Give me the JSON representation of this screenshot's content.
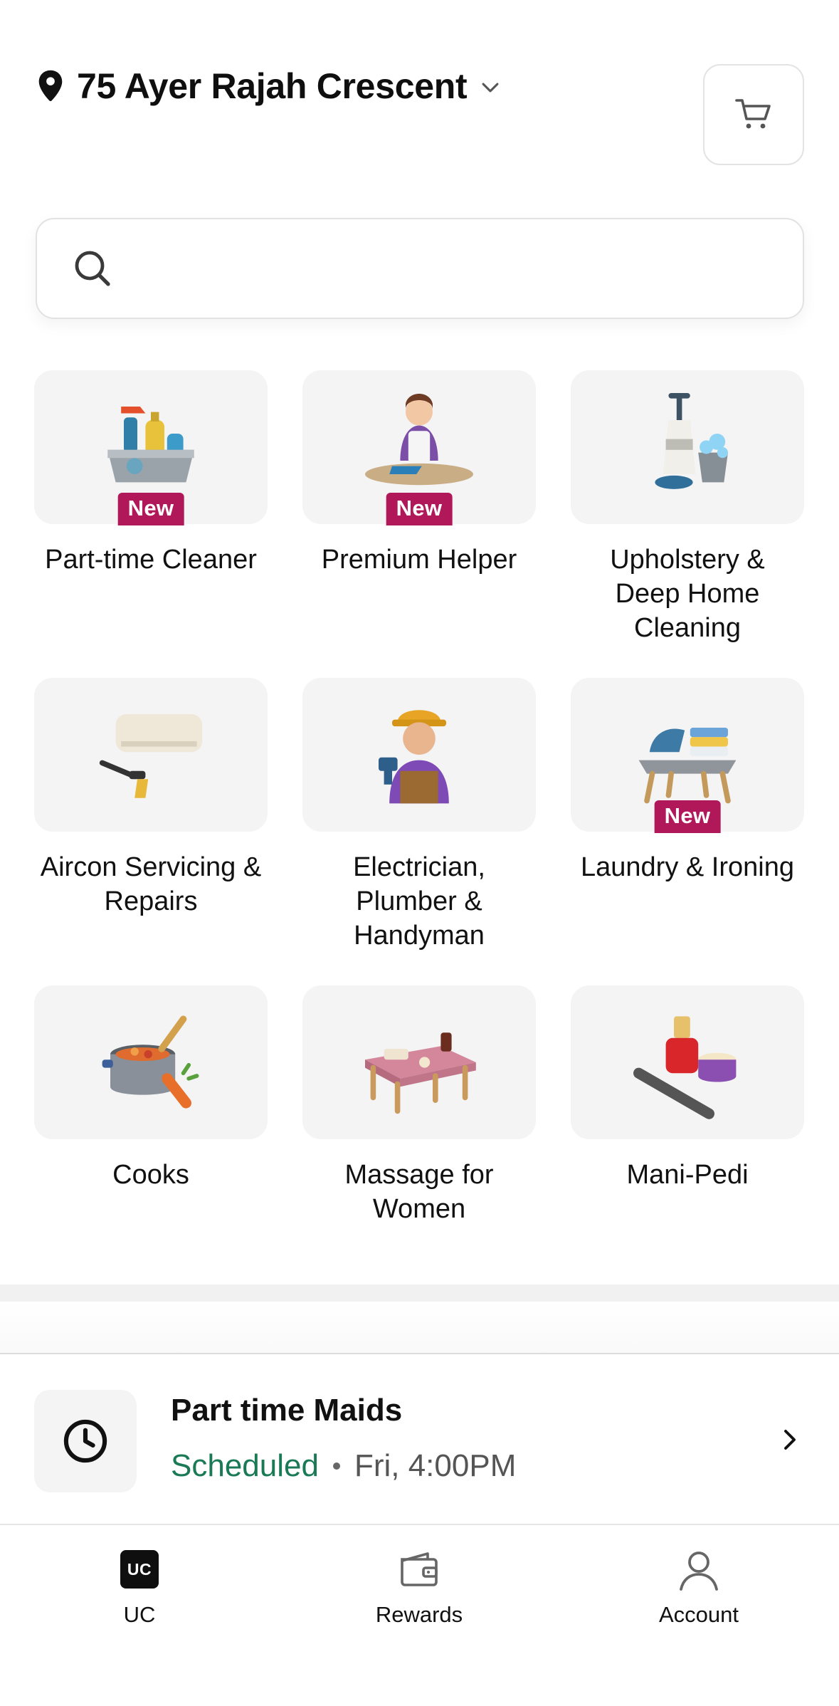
{
  "header": {
    "address": "75 Ayer Rajah Crescent",
    "icons": {
      "location": "location-pin-icon",
      "dropdown": "chevron-down-icon",
      "cart": "cart-icon"
    }
  },
  "search": {
    "placeholder": "",
    "value": "",
    "icon": "search-icon"
  },
  "services": [
    {
      "label": "Part-time Cleaner",
      "badge": "New",
      "icon": "cleaning-supplies-icon"
    },
    {
      "label": "Premium Helper",
      "badge": "New",
      "icon": "helper-ironing-icon"
    },
    {
      "label": "Upholstery & Deep Home Cleaning",
      "badge": "",
      "icon": "floor-scrubber-icon"
    },
    {
      "label": "Aircon Servicing & Repairs",
      "badge": "",
      "icon": "aircon-icon"
    },
    {
      "label": "Electrician, Plumber & Handyman",
      "badge": "",
      "icon": "handyman-icon"
    },
    {
      "label": "Laundry & Ironing",
      "badge": "New",
      "icon": "laundry-iron-icon"
    },
    {
      "label": "Cooks",
      "badge": "",
      "icon": "cooking-pot-icon"
    },
    {
      "label": "Massage for Women",
      "badge": "",
      "icon": "massage-table-icon"
    },
    {
      "label": "Mani-Pedi",
      "badge": "",
      "icon": "nail-polish-icon"
    }
  ],
  "booking": {
    "title": "Part time Maids",
    "status": "Scheduled",
    "time": "Fri, 4:00PM",
    "status_color": "#1a7a55",
    "icon": "clock-icon"
  },
  "nav": {
    "items": [
      {
        "label": "UC",
        "logo_text": "UC",
        "icon": "uc-logo-icon"
      },
      {
        "label": "Rewards",
        "icon": "wallet-icon"
      },
      {
        "label": "Account",
        "icon": "account-icon"
      }
    ]
  },
  "colors": {
    "badge": "#b0185a",
    "card_bg": "#f4f4f5",
    "accent_green": "#1a7a55"
  }
}
